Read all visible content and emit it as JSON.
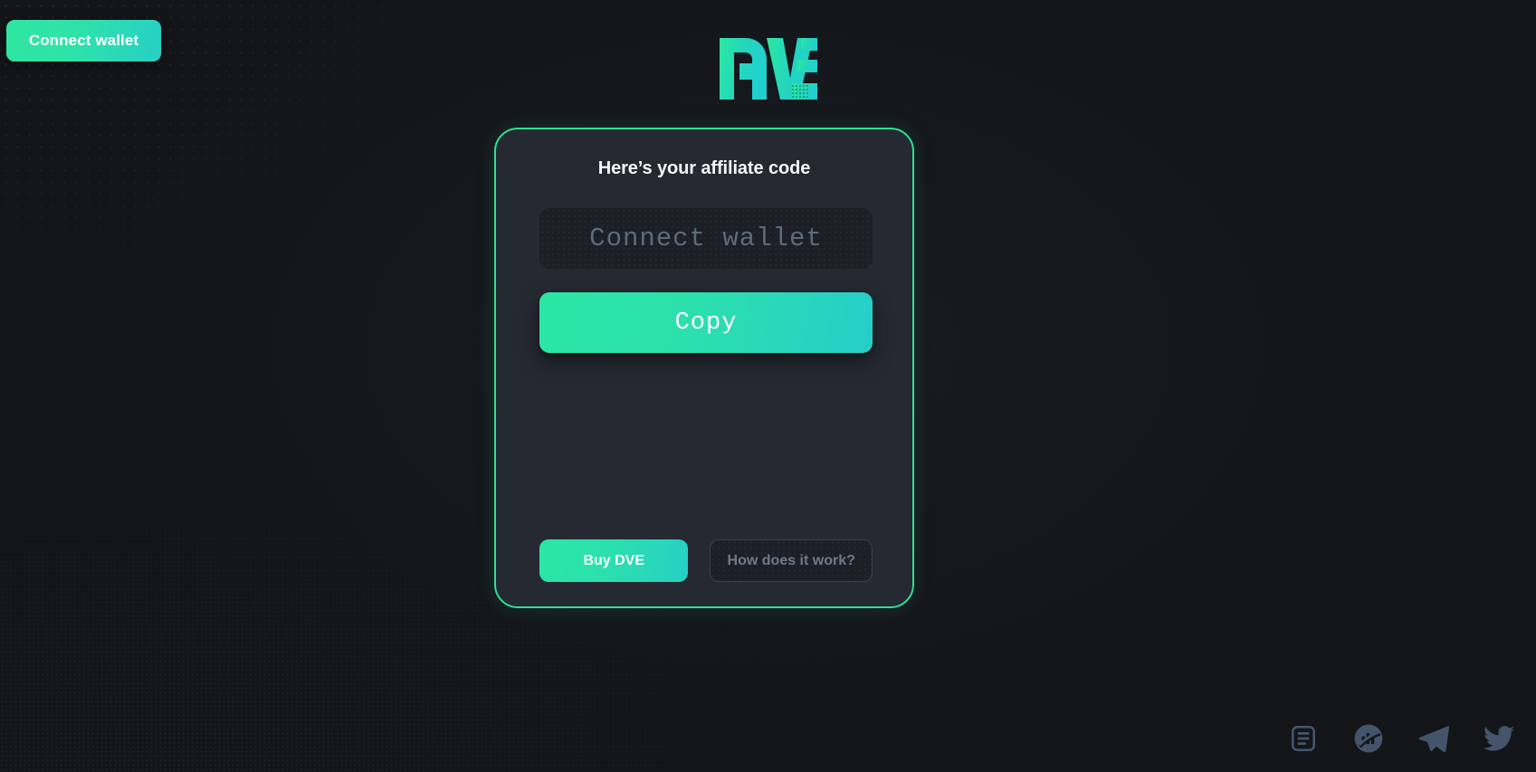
{
  "page": {
    "background_color": "#131519",
    "accent_color": "#2fe08f",
    "accent_gradient_from": "#2ae6a4",
    "accent_gradient_to": "#25cec9"
  },
  "header": {
    "connect_wallet_label": "Connect wallet",
    "logo_text": "DVE",
    "logo_icon": "dve-logo"
  },
  "card": {
    "title": "Here’s your affiliate code",
    "code_input": {
      "value": "",
      "placeholder": "Connect wallet"
    },
    "copy_label": "Copy",
    "buy_label": "Buy DVE",
    "how_it_works_label": "How does it work?",
    "border_color": "#2fe08f",
    "background_color": "#242932"
  },
  "social": {
    "items": [
      {
        "name": "docs-icon",
        "label": "Docs"
      },
      {
        "name": "dextools-icon",
        "label": "DEXTools"
      },
      {
        "name": "telegram-icon",
        "label": "Telegram"
      },
      {
        "name": "twitter-icon",
        "label": "Twitter"
      }
    ],
    "color": "#44556b"
  }
}
